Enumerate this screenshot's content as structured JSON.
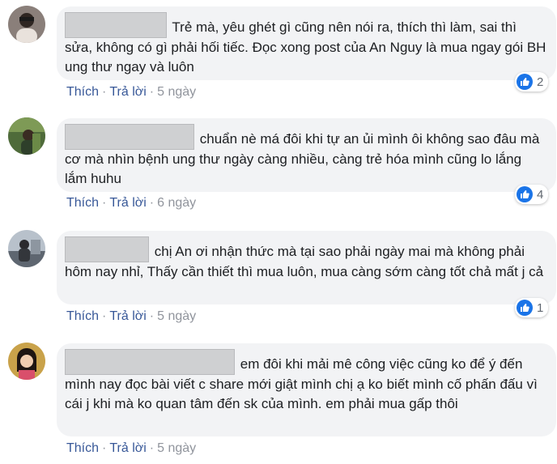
{
  "colors": {
    "link": "#385898",
    "meta": "#90949c",
    "bubble": "#f2f3f5",
    "like": "#1a74e8"
  },
  "comments": [
    {
      "text": "Trẻ mà, yêu ghét gì cũng nên nói ra, thích thì làm, sai thì sửa, không có gì phải hối tiếc. Đọc xong post của An Nguy là mua ngay gói BH ung thư ngay và luôn",
      "like_label": "Thích",
      "reply_label": "Trả lời",
      "time": "5 ngày",
      "reactions": "2",
      "avatar_icon": "user-avatar-icon"
    },
    {
      "text": "chuẩn nè má đôi khi tự an ủi mình ôi không sao đâu mà cơ mà nhìn bệnh ung thư ngày càng nhiều, càng trẻ hóa mình cũng lo lắng lắm huhu",
      "like_label": "Thích",
      "reply_label": "Trả lời",
      "time": "6 ngày",
      "reactions": "4",
      "avatar_icon": "user-avatar-icon"
    },
    {
      "text": "chị An ơi nhận thức mà tại sao phải ngày mai mà không phải hôm nay nhỉ, Thấy cần thiết thì mua luôn, mua càng sớm càng tốt chả mất j cả",
      "like_label": "Thích",
      "reply_label": "Trả lời",
      "time": "5 ngày",
      "reactions": "1",
      "avatar_icon": "user-avatar-icon"
    },
    {
      "text": "em đôi khi mải mê công việc cũng ko để ý đến mình nay đọc bài viết c share mới giật mình chị ạ ko biết mình cố phấn đấu vì cái j khi mà ko quan tâm đến sk của mình. em phải mua gấp thôi",
      "like_label": "Thích",
      "reply_label": "Trả lời",
      "time": "5 ngày",
      "reactions": "",
      "avatar_icon": "user-avatar-icon"
    }
  ]
}
